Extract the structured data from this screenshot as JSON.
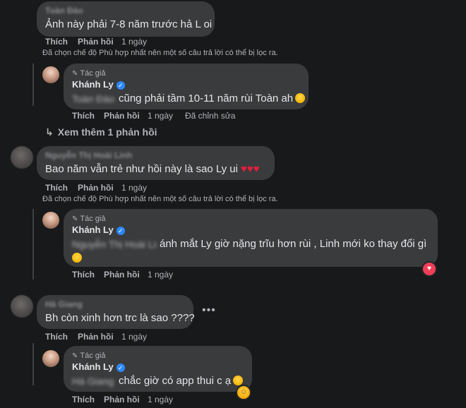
{
  "actions": {
    "like": "Thích",
    "reply": "Phản hồi",
    "time_1_day": "1 ngày",
    "edited": "Đã chỉnh sửa"
  },
  "filter_note": "Đã chọn chế độ Phù hợp nhất nên một số câu trả lời có thể bị lọc ra.",
  "author_badge": "Tác giả",
  "author_name": "Khánh Ly",
  "see_more": "Xem thêm 1 phản hồi",
  "comments": [
    {
      "name": "Toàn Đào",
      "text": "Ảnh này phải 7-8 năm trước hả L oi",
      "reply": {
        "mention": "Toàn Đào",
        "text": "cũng phải tầm 10-11 năm rùi Toàn ah"
      }
    },
    {
      "name": "Nguyễn Thị Hoài Linh",
      "text": "Bao năm vẫn trẻ như hồi này là sao Ly ui",
      "hearts": "♥♥♥",
      "reply": {
        "mention": "Nguyễn Thị Hoài Linh",
        "text": "ánh mắt Ly giờ nặng trĩu hơn rùi , Linh mới ko thay đổi gì"
      }
    },
    {
      "name": "Hà Giang",
      "text": "Bh còn xinh hơn trc là sao ????",
      "more": "•••",
      "reply": {
        "mention": "Hà Giang",
        "text": "chắc giờ có app thui c ạ"
      }
    }
  ],
  "icons": {
    "pen": "pen-icon",
    "verified": "verified-badge-icon",
    "reply_arrow": "reply-arrow-icon",
    "emoji": "smiling-face-emoji",
    "heart_react": "love-reaction-icon",
    "haha_react": "haha-reaction-icon"
  },
  "colors": {
    "background": "#18191a",
    "bubble": "#3a3b3c",
    "text": "#e4e6eb",
    "muted": "#b0b3b8",
    "verified": "#2d88ff",
    "heart": "#e41e3f"
  }
}
